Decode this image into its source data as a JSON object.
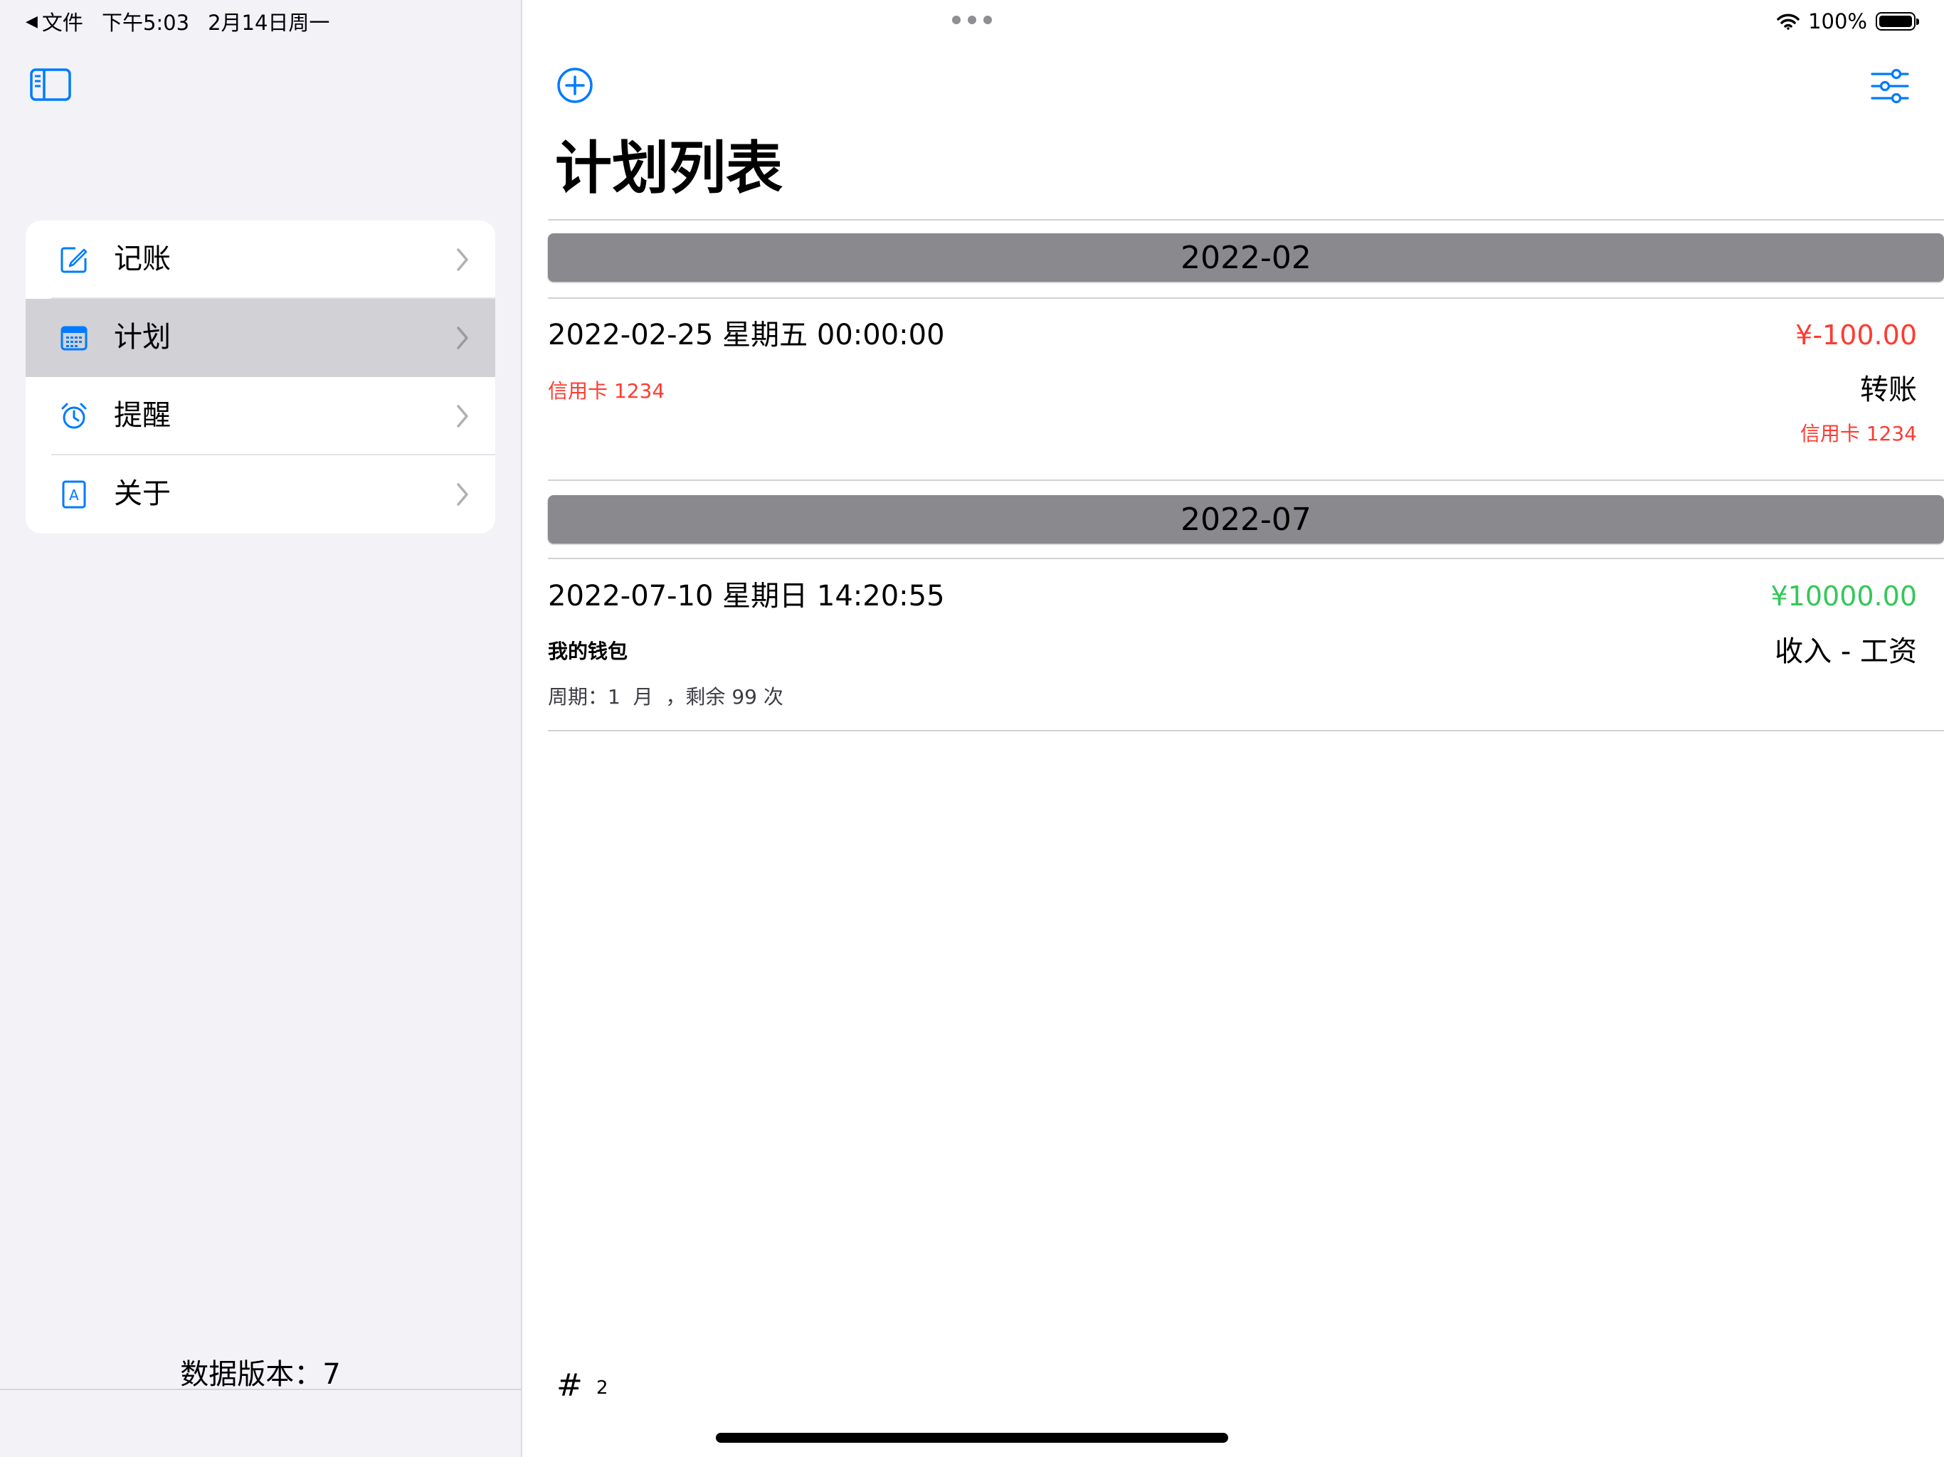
{
  "status": {
    "back_label": "文件",
    "time": "下午5:03",
    "date": "2月14日周一",
    "battery": "100%"
  },
  "sidebar": {
    "items": [
      {
        "label": "记账",
        "icon": "edit-icon",
        "selected": false
      },
      {
        "label": "计划",
        "icon": "calendar-icon",
        "selected": true
      },
      {
        "label": "提醒",
        "icon": "alarm-icon",
        "selected": false
      },
      {
        "label": "关于",
        "icon": "about-icon",
        "selected": false
      }
    ],
    "data_version": "数据版本：7"
  },
  "main": {
    "title": "计划列表",
    "sections": [
      {
        "header": "2022-02",
        "rows": [
          {
            "datetime": "2022-02-25 星期五 00:00:00",
            "amount": "¥-100.00",
            "account": "信用卡 1234",
            "category": "转账",
            "target_account": "信用卡 1234"
          }
        ]
      },
      {
        "header": "2022-07",
        "rows": [
          {
            "datetime": "2022-07-10 星期日 14:20:55",
            "amount": "¥10000.00",
            "account": "我的钱包",
            "category": "收入 - 工资",
            "period": "周期：1  月  ，剩余 99 次"
          }
        ]
      }
    ],
    "count_symbol": "#",
    "count": "2"
  },
  "colors": {
    "accent": "#007aff",
    "expense": "#ff3b30",
    "income": "#34c759",
    "section_header": "#8a8a8e"
  }
}
